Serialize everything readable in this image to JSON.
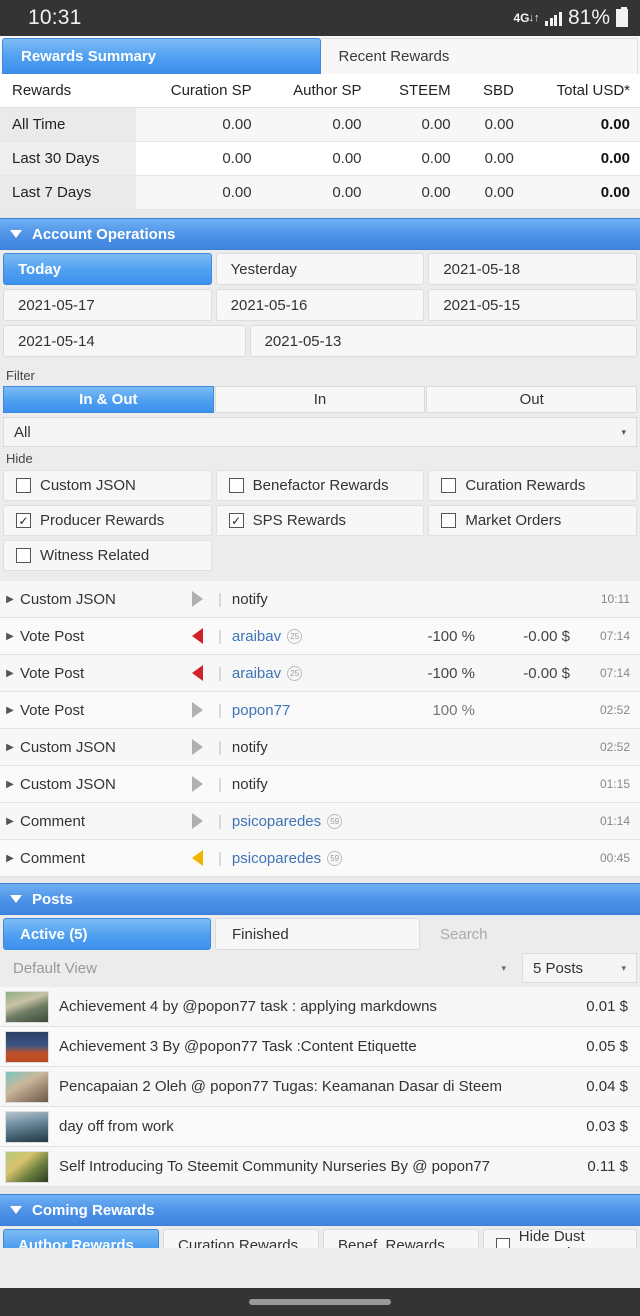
{
  "statusbar": {
    "time": "10:31",
    "network": "4G",
    "arrows": "↓↑",
    "battery_pct": "81%"
  },
  "tabs": [
    {
      "label": "Rewards Summary",
      "active": true
    },
    {
      "label": "Recent Rewards",
      "active": false
    }
  ],
  "rewards_table": {
    "headers": [
      "Rewards",
      "Curation SP",
      "Author SP",
      "STEEM",
      "SBD",
      "Total USD*"
    ],
    "rows": [
      {
        "label": "All Time",
        "curation_sp": "0.00",
        "author_sp": "0.00",
        "steem": "0.00",
        "sbd": "0.00",
        "total_usd": "0.00"
      },
      {
        "label": "Last 30 Days",
        "curation_sp": "0.00",
        "author_sp": "0.00",
        "steem": "0.00",
        "sbd": "0.00",
        "total_usd": "0.00"
      },
      {
        "label": "Last 7 Days",
        "curation_sp": "0.00",
        "author_sp": "0.00",
        "steem": "0.00",
        "sbd": "0.00",
        "total_usd": "0.00"
      }
    ]
  },
  "account_operations": {
    "title": "Account Operations",
    "date_chips": [
      [
        {
          "label": "Today",
          "active": true
        },
        {
          "label": "Yesterday",
          "active": false
        },
        {
          "label": "2021-05-18",
          "active": false
        }
      ],
      [
        {
          "label": "2021-05-17",
          "active": false
        },
        {
          "label": "2021-05-16",
          "active": false
        },
        {
          "label": "2021-05-15",
          "active": false
        }
      ],
      [
        {
          "label": "2021-05-14",
          "active": false
        },
        {
          "label": "2021-05-13",
          "active": false
        }
      ]
    ],
    "filter_label": "Filter",
    "filter_segments": [
      {
        "label": "In & Out",
        "active": true
      },
      {
        "label": "In",
        "active": false
      },
      {
        "label": "Out",
        "active": false
      }
    ],
    "filter_select": {
      "value": "All"
    },
    "hide_label": "Hide",
    "hide_options": [
      [
        {
          "label": "Custom JSON",
          "checked": false
        },
        {
          "label": "Benefactor Rewards",
          "checked": false
        },
        {
          "label": "Curation Rewards",
          "checked": false
        }
      ],
      [
        {
          "label": "Producer Rewards",
          "checked": true
        },
        {
          "label": "SPS Rewards",
          "checked": true
        },
        {
          "label": "Market Orders",
          "checked": false
        }
      ],
      [
        {
          "label": "Witness Related",
          "checked": false
        }
      ]
    ],
    "operations": [
      {
        "type": "Custom JSON",
        "direction": "neutral",
        "target": "notify",
        "reputation": "",
        "pct": "",
        "value": "",
        "time": "10:11"
      },
      {
        "type": "Vote Post",
        "direction": "out",
        "target": "araibav",
        "reputation": "25",
        "pct": "-100 %",
        "value": "-0.00 $",
        "time": "07:14"
      },
      {
        "type": "Vote Post",
        "direction": "out",
        "target": "araibav",
        "reputation": "25",
        "pct": "-100 %",
        "value": "-0.00 $",
        "time": "07:14"
      },
      {
        "type": "Vote Post",
        "direction": "neutral",
        "target": "popon77",
        "reputation": "",
        "pct": "100 %",
        "value": "",
        "time": "02:52"
      },
      {
        "type": "Custom JSON",
        "direction": "neutral",
        "target": "notify",
        "reputation": "",
        "pct": "",
        "value": "",
        "time": "02:52"
      },
      {
        "type": "Custom JSON",
        "direction": "neutral",
        "target": "notify",
        "reputation": "",
        "pct": "",
        "value": "",
        "time": "01:15"
      },
      {
        "type": "Comment",
        "direction": "neutral",
        "target": "psicoparedes",
        "reputation": "59",
        "pct": "",
        "value": "",
        "time": "01:14"
      },
      {
        "type": "Comment",
        "direction": "pending",
        "target": "psicoparedes",
        "reputation": "59",
        "pct": "",
        "value": "",
        "time": "00:45"
      }
    ]
  },
  "posts": {
    "title": "Posts",
    "tabs": [
      {
        "label": "Active (5)",
        "active": true
      },
      {
        "label": "Finished",
        "active": false
      }
    ],
    "search_placeholder": "Search",
    "view_select": {
      "value": "Default View"
    },
    "count_select": {
      "value": "5 Posts"
    },
    "items": [
      {
        "title": "Achievement 4 by @popon77 task : applying markdowns",
        "value": "0.01 $"
      },
      {
        "title": "Achievement 3 By @popon77 Task :Content Etiquette",
        "value": "0.05 $"
      },
      {
        "title": "Pencapaian 2 Oleh @ popon77 Tugas: Keamanan Dasar di Steem",
        "value": "0.04 $"
      },
      {
        "title": "day off from work",
        "value": "0.03 $"
      },
      {
        "title": "Self Introducing To Steemit Community Nurseries By @ popon77",
        "value": "0.11 $"
      }
    ]
  },
  "coming_rewards": {
    "title": "Coming Rewards",
    "chips": [
      {
        "label": "Author Rewards",
        "active": true,
        "checkbox": false
      },
      {
        "label": "Curation Rewards",
        "active": false,
        "checkbox": false
      },
      {
        "label": "Benef. Rewards",
        "active": false,
        "checkbox": false
      },
      {
        "label": "Hide Dust Rewards",
        "active": false,
        "checkbox": true
      }
    ]
  }
}
